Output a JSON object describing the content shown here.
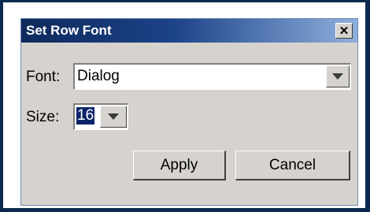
{
  "dialog": {
    "title": "Set Row Font",
    "close_glyph": "✕",
    "font_label": "Font:",
    "font_value": "Dialog",
    "size_label": "Size:",
    "size_value": "16",
    "apply_label": "Apply",
    "cancel_label": "Cancel"
  },
  "colors": {
    "background": "#0a2a4f",
    "dialog_bg": "#d6d3ce",
    "title_start": "#0e2a5c",
    "title_end": "#8fb0dd",
    "selection": "#0a246a"
  },
  "icons": {
    "close": "close-icon",
    "dropdown": "chevron-down-icon"
  }
}
